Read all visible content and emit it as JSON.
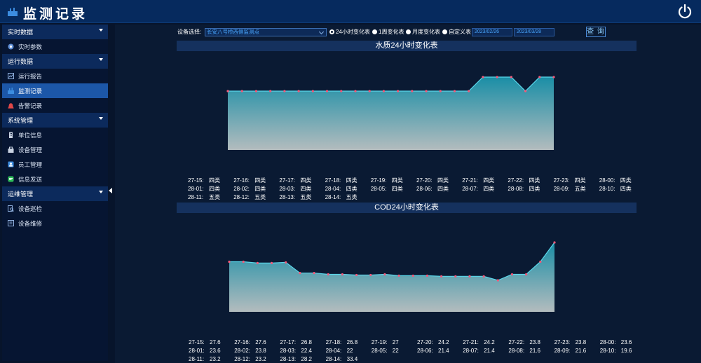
{
  "header": {
    "title": "监测记录"
  },
  "sidebar": {
    "groups": [
      {
        "label": "实时数据",
        "items": [
          {
            "label": "实时参数",
            "icon": "realtime-icon"
          }
        ]
      },
      {
        "label": "运行数据",
        "items": [
          {
            "label": "运行报告",
            "icon": "report-icon"
          },
          {
            "label": "监测记录",
            "icon": "monitor-icon",
            "active": true
          },
          {
            "label": "告警记录",
            "icon": "alarm-icon"
          }
        ]
      },
      {
        "label": "系统管理",
        "items": [
          {
            "label": "单位信息",
            "icon": "building-icon"
          },
          {
            "label": "设备管理",
            "icon": "device-icon"
          },
          {
            "label": "员工管理",
            "icon": "staff-icon"
          },
          {
            "label": "信息发送",
            "icon": "message-icon"
          }
        ]
      },
      {
        "label": "运维管理",
        "items": [
          {
            "label": "设备巡检",
            "icon": "inspect-icon"
          },
          {
            "label": "设备维修",
            "icon": "repair-icon"
          }
        ]
      }
    ]
  },
  "toolbar": {
    "device_label": "设备选择:",
    "device_value": "长安八号桥西侧监测点",
    "radios": [
      {
        "label": "24小时变化表",
        "checked": true
      },
      {
        "label": "1周变化表",
        "checked": false
      },
      {
        "label": "月度变化表",
        "checked": false
      },
      {
        "label": "自定义表",
        "checked": false
      }
    ],
    "start_date": "2023/02/26",
    "end_date": "2023/03/28",
    "query_label": "查 询"
  },
  "colors": {
    "area_top": "#1a8ea6",
    "area_bottom": "#b3bcbe",
    "line": "#5ad6ea",
    "point": "#f25a7a",
    "accent": "#1c57a8"
  },
  "chart_data": [
    {
      "type": "area",
      "title": "水质24小时变化表",
      "categories": [
        "27-15",
        "27-16",
        "27-17",
        "27-18",
        "27-19",
        "27-20",
        "27-21",
        "27-22",
        "27-23",
        "28-00",
        "28-01",
        "28-02",
        "28-03",
        "28-04",
        "28-05",
        "28-06",
        "28-07",
        "28-08",
        "28-09",
        "28-10",
        "28-11",
        "28-12",
        "28-13",
        "28-14"
      ],
      "value_labels": [
        "四类",
        "四类",
        "四类",
        "四类",
        "四类",
        "四类",
        "四类",
        "四类",
        "四类",
        "四类",
        "四类",
        "四类",
        "四类",
        "四类",
        "四类",
        "四类",
        "四类",
        "四类",
        "五类",
        "四类",
        "五类",
        "五类",
        "五类",
        "五类"
      ],
      "values": [
        4,
        4,
        4,
        4,
        4,
        4,
        4,
        4,
        4,
        4,
        4,
        4,
        4,
        4,
        4,
        4,
        4,
        4,
        5,
        5,
        5,
        4,
        5,
        5
      ]
    },
    {
      "type": "area",
      "title": "COD24小时变化表",
      "categories": [
        "27-15",
        "27-16",
        "27-17",
        "27-18",
        "27-19",
        "27-20",
        "27-21",
        "27-22",
        "27-23",
        "28-00",
        "28-01",
        "28-02",
        "28-03",
        "28-04",
        "28-05",
        "28-06",
        "28-07",
        "28-08",
        "28-09",
        "28-10",
        "28-11",
        "28-12",
        "28-13",
        "28-14"
      ],
      "value_labels": [
        "27.6",
        "27.6",
        "26.8",
        "26.8",
        "27",
        "24.2",
        "24.2",
        "23.8",
        "23.8",
        "23.6",
        "23.6",
        "23.8",
        "22.4",
        "22",
        "22",
        "21.4",
        "21.4",
        "21.6",
        "21.6",
        "19.6",
        "23.2",
        "23.2",
        "28.2",
        "33.4"
      ],
      "values": [
        27.6,
        27.6,
        27.2,
        27.2,
        27.4,
        24.2,
        24.2,
        23.8,
        23.8,
        23.6,
        23.6,
        23.8,
        23.4,
        23.4,
        23.4,
        23.2,
        23.2,
        23.2,
        23.2,
        22.0,
        23.8,
        23.8,
        27.6,
        33.4
      ]
    }
  ]
}
